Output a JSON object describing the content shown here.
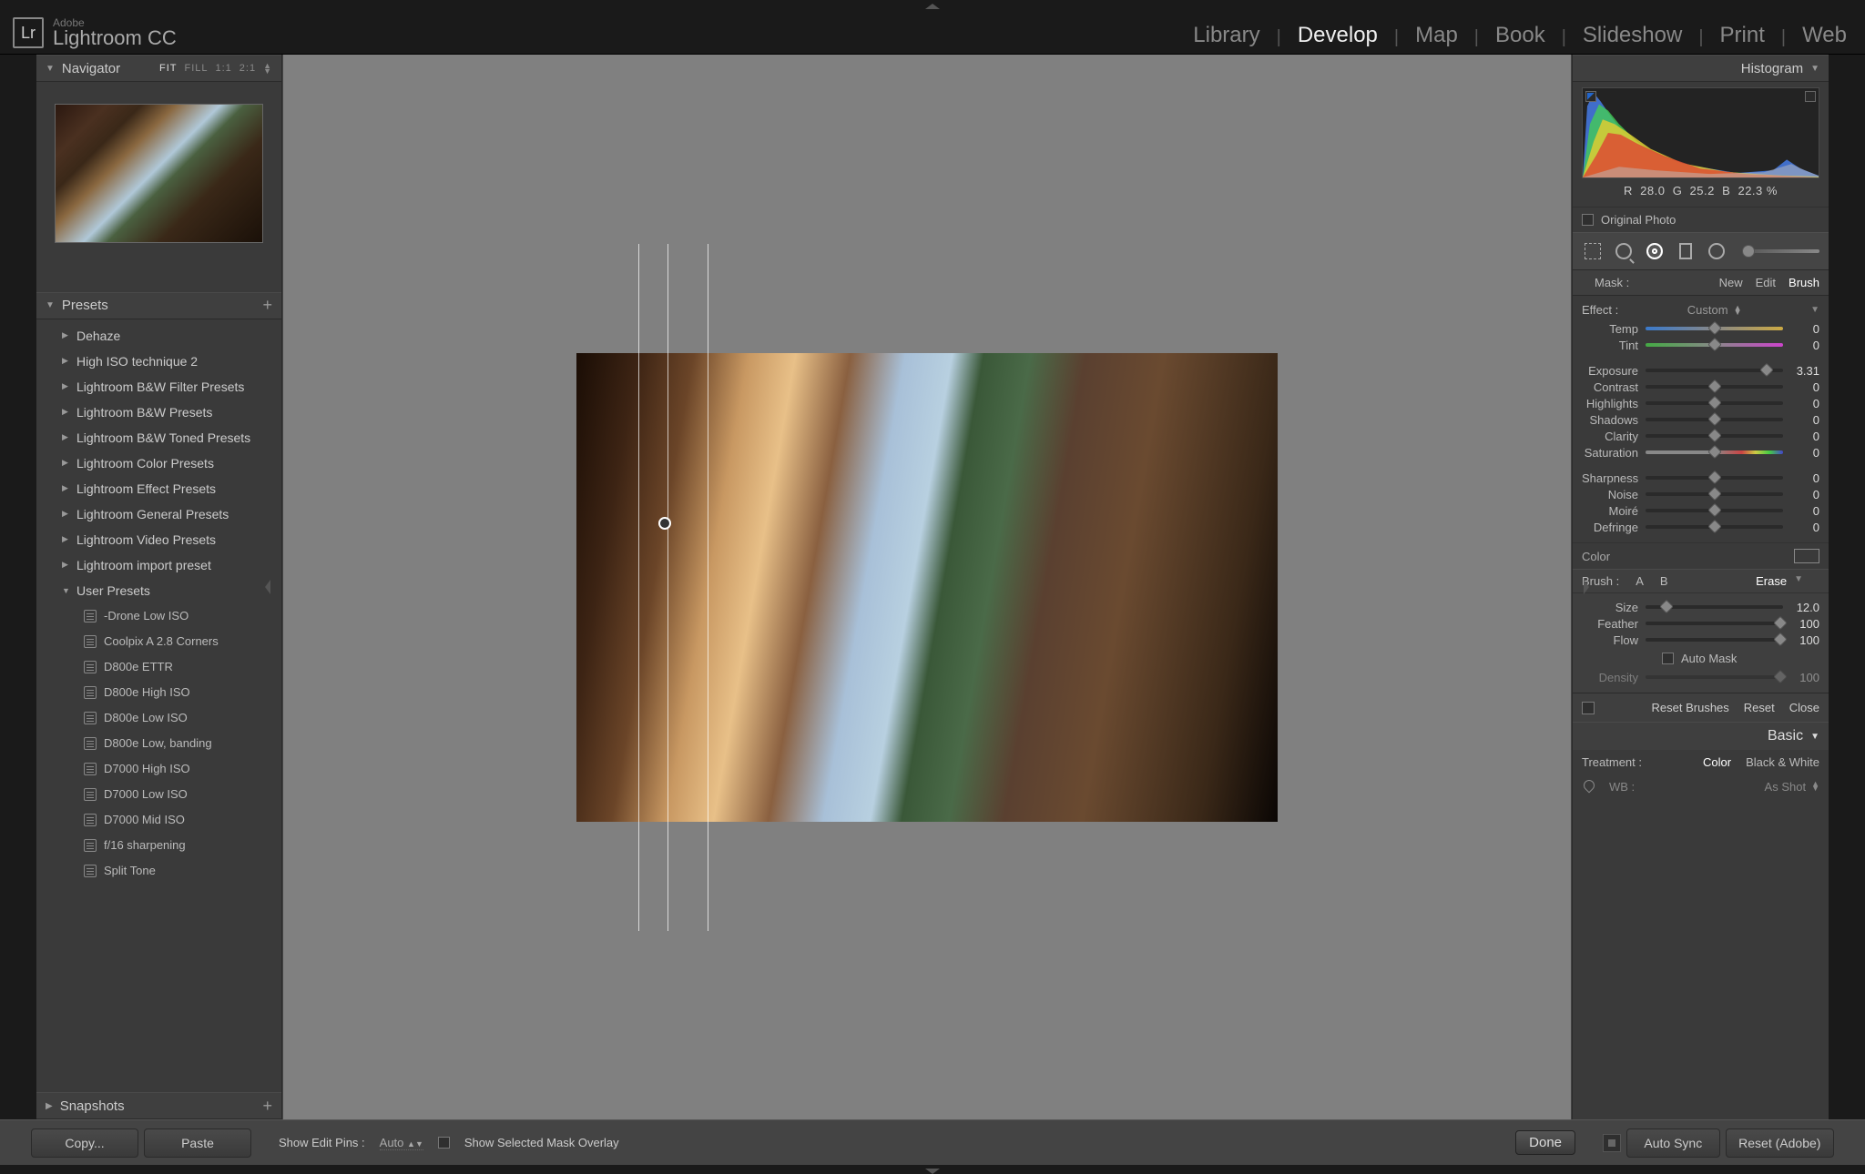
{
  "brand": {
    "top": "Adobe",
    "name": "Lightroom CC",
    "icon": "Lr"
  },
  "modules": [
    "Library",
    "Develop",
    "Map",
    "Book",
    "Slideshow",
    "Print",
    "Web"
  ],
  "modules_active": "Develop",
  "navigator": {
    "title": "Navigator",
    "ratios": [
      "FIT",
      "FILL",
      "1:1",
      "2:1"
    ],
    "ratio_active": "FIT"
  },
  "presets": {
    "title": "Presets",
    "folders": [
      "Dehaze",
      "High ISO technique 2",
      "Lightroom B&W Filter Presets",
      "Lightroom B&W Presets",
      "Lightroom B&W Toned Presets",
      "Lightroom Color Presets",
      "Lightroom Effect Presets",
      "Lightroom General Presets",
      "Lightroom Video Presets",
      "Lightroom import preset"
    ],
    "user_folder": "User Presets",
    "user_items": [
      "-Drone Low ISO",
      "Coolpix A 2.8 Corners",
      "D800e ETTR",
      "D800e High ISO",
      "D800e Low ISO",
      "D800e Low, banding",
      "D7000 High ISO",
      "D7000 Low ISO",
      "D7000 Mid ISO",
      "f/16 sharpening",
      "Split Tone"
    ]
  },
  "snapshots": {
    "title": "Snapshots"
  },
  "histogram": {
    "title": "Histogram",
    "rgb": {
      "r": "28.0",
      "g": "25.2",
      "b": "22.3",
      "suffix": "%"
    },
    "original": "Original Photo"
  },
  "mask": {
    "label": "Mask :",
    "options": [
      "New",
      "Edit",
      "Brush"
    ],
    "active": "Brush"
  },
  "effect": {
    "label": "Effect :",
    "value": "Custom"
  },
  "sliders": {
    "temp": {
      "label": "Temp",
      "value": "0",
      "pos": 50
    },
    "tint": {
      "label": "Tint",
      "value": "0",
      "pos": 50
    },
    "exposure": {
      "label": "Exposure",
      "value": "3.31",
      "pos": 88
    },
    "contrast": {
      "label": "Contrast",
      "value": "0",
      "pos": 50
    },
    "highlights": {
      "label": "Highlights",
      "value": "0",
      "pos": 50
    },
    "shadows": {
      "label": "Shadows",
      "value": "0",
      "pos": 50
    },
    "clarity": {
      "label": "Clarity",
      "value": "0",
      "pos": 50
    },
    "saturation": {
      "label": "Saturation",
      "value": "0",
      "pos": 50
    },
    "sharpness": {
      "label": "Sharpness",
      "value": "0",
      "pos": 50
    },
    "noise": {
      "label": "Noise",
      "value": "0",
      "pos": 50
    },
    "moire": {
      "label": "Moiré",
      "value": "0",
      "pos": 50
    },
    "defringe": {
      "label": "Defringe",
      "value": "0",
      "pos": 50
    }
  },
  "color_label": "Color",
  "brush": {
    "label": "Brush :",
    "a": "A",
    "b": "B",
    "erase": "Erase",
    "size": {
      "label": "Size",
      "value": "12.0",
      "pos": 15
    },
    "feather": {
      "label": "Feather",
      "value": "100",
      "pos": 98
    },
    "flow": {
      "label": "Flow",
      "value": "100",
      "pos": 98
    },
    "automask": "Auto Mask",
    "density": {
      "label": "Density",
      "value": "100",
      "pos": 98
    }
  },
  "reset": {
    "brushes": "Reset Brushes",
    "reset": "Reset",
    "close": "Close"
  },
  "basic": {
    "title": "Basic",
    "treatment": "Treatment :",
    "color": "Color",
    "bw": "Black & White",
    "wb": "WB :",
    "wb_val": "As Shot"
  },
  "bottom": {
    "copy": "Copy...",
    "paste": "Paste",
    "pins_label": "Show Edit Pins :",
    "pins_val": "Auto",
    "overlay": "Show Selected Mask Overlay",
    "done": "Done",
    "autosync": "Auto Sync",
    "reset": "Reset (Adobe)"
  }
}
